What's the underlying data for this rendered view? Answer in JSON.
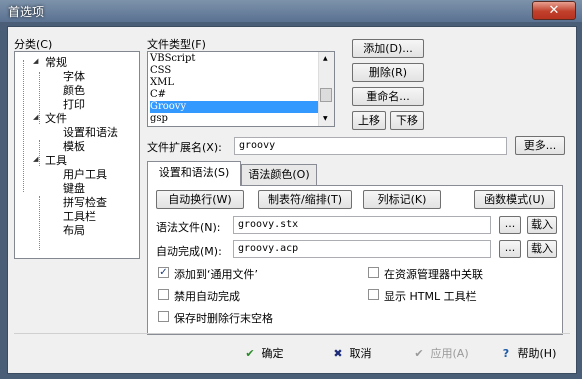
{
  "window": {
    "title": "首选项",
    "close_symbol": "✕"
  },
  "tree": {
    "label": "分类(C)",
    "nodes": [
      {
        "label": "常规",
        "expander": "◢"
      },
      {
        "label": "字体"
      },
      {
        "label": "颜色"
      },
      {
        "label": "打印"
      },
      {
        "label": "文件",
        "expander": "◢"
      },
      {
        "label": "设置和语法"
      },
      {
        "label": "模板"
      },
      {
        "label": "工具",
        "expander": "◢"
      },
      {
        "label": "用户工具"
      },
      {
        "label": "键盘"
      },
      {
        "label": "拼写检查"
      },
      {
        "label": "工具栏"
      },
      {
        "label": "布局"
      }
    ]
  },
  "filetypes": {
    "label": "文件类型(F)",
    "items": [
      "VBScript",
      "CSS",
      "XML",
      "C#",
      "Groovy",
      "gsp"
    ],
    "selected": "Groovy"
  },
  "side_buttons": {
    "add": "添加(D)...",
    "delete": "删除(R)",
    "rename": "重命名...",
    "up": "上移",
    "down": "下移"
  },
  "extension": {
    "label": "文件扩展名(X):",
    "value": "groovy",
    "more": "更多..."
  },
  "tabs": [
    {
      "label": "设置和语法(S)"
    },
    {
      "label": "语法颜色(O)"
    }
  ],
  "actions": {
    "autowrap": "自动换行(W)",
    "tabs": "制表符/缩排(T)",
    "columns": "列标记(K)",
    "function": "函数模式(U)"
  },
  "syntax_file": {
    "label": "语法文件(N):",
    "value": "groovy.stx",
    "browse": "...",
    "load": "载入"
  },
  "autocomplete": {
    "label": "自动完成(M):",
    "value": "groovy.acp",
    "browse": "...",
    "load": "载入"
  },
  "options": {
    "add_common": {
      "label": "添加到‘通用文件’",
      "checked": true,
      "mark": "✓"
    },
    "explorer": {
      "label": "在资源管理器中关联",
      "checked": false
    },
    "disable_ac": {
      "label": "禁用自动完成",
      "checked": false
    },
    "html_toolbar": {
      "label": "显示 HTML 工具栏",
      "checked": false
    },
    "strip_ws": {
      "label": "保存时删除行末空格",
      "checked": false
    }
  },
  "footer": {
    "ok": "确定",
    "cancel": "取消",
    "apply": "应用(A)",
    "help": "帮助(H)"
  },
  "icons": {
    "ok": "✔",
    "cancel": "✖",
    "apply": "✔",
    "help": "?"
  },
  "colors": {
    "ok": "#2a8a2a",
    "cancel": "#1c2c78",
    "apply": "#9a9a9a",
    "help": "#1c5aa8",
    "selection": "#3399ff"
  }
}
